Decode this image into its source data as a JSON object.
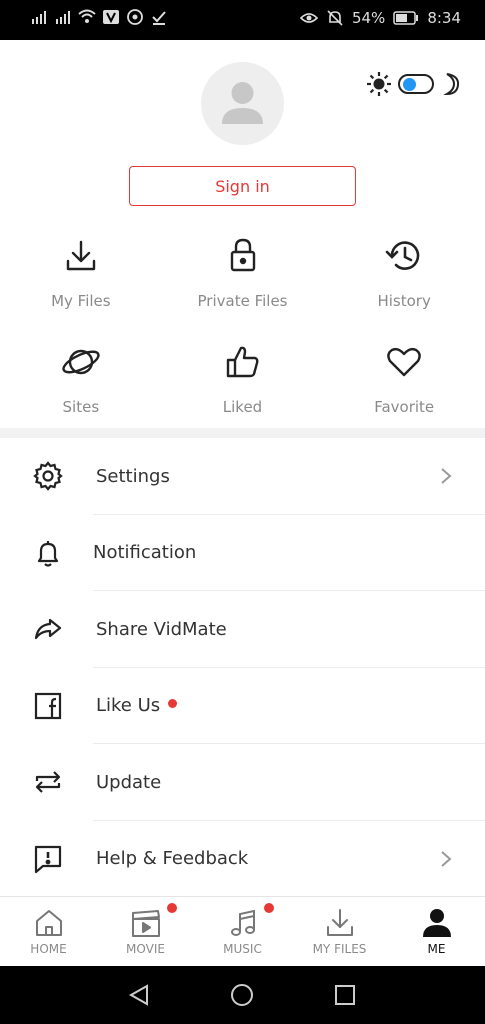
{
  "status_bar": {
    "left_icons": [
      "signal-e-icon",
      "signal-4g-icon",
      "wifi-icon",
      "vidmate-icon",
      "whatsapp-icon",
      "check-icon"
    ],
    "battery": "54%",
    "time": "8:34"
  },
  "profile": {
    "sign_in_label": "Sign in"
  },
  "quick_actions": [
    {
      "label": "My Files",
      "icon": "download-icon"
    },
    {
      "label": "Private Files",
      "icon": "lock-icon"
    },
    {
      "label": "History",
      "icon": "history-icon"
    },
    {
      "label": "Sites",
      "icon": "planet-icon"
    },
    {
      "label": "Liked",
      "icon": "thumbs-up-icon"
    },
    {
      "label": "Favorite",
      "icon": "heart-icon"
    }
  ],
  "menu": [
    {
      "label": "Settings",
      "icon": "gear-icon",
      "chevron": true,
      "dot": false
    },
    {
      "label": "Notification",
      "icon": "bell-icon",
      "chevron": false,
      "dot": false
    },
    {
      "label": "Share VidMate",
      "icon": "share-icon",
      "chevron": false,
      "dot": false
    },
    {
      "label": "Like Us",
      "icon": "facebook-icon",
      "chevron": false,
      "dot": true
    },
    {
      "label": "Update",
      "icon": "update-icon",
      "chevron": false,
      "dot": false
    },
    {
      "label": "Help & Feedback",
      "icon": "feedback-icon",
      "chevron": true,
      "dot": false
    }
  ],
  "bottom_nav": [
    {
      "label": "HOME",
      "icon": "home-icon",
      "active": false,
      "dot": false
    },
    {
      "label": "MOVIE",
      "icon": "movie-icon",
      "active": false,
      "dot": true
    },
    {
      "label": "MUSIC",
      "icon": "music-icon",
      "active": false,
      "dot": true
    },
    {
      "label": "MY FILES",
      "icon": "download-icon",
      "active": false,
      "dot": false
    },
    {
      "label": "ME",
      "icon": "person-icon",
      "active": true,
      "dot": false
    }
  ],
  "colors": {
    "accent": "#e53935",
    "toggle": "#2196f3"
  }
}
